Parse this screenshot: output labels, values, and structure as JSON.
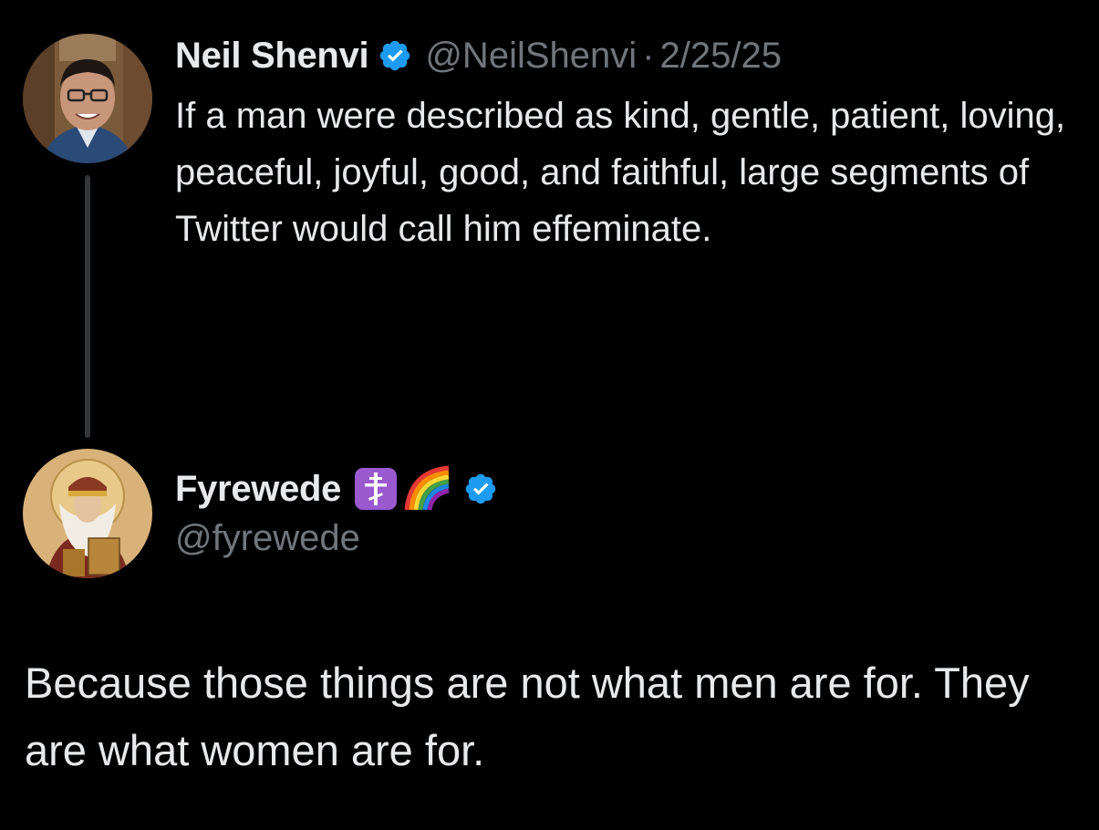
{
  "original_tweet": {
    "display_name": "Neil Shenvi",
    "handle": "@NeilShenvi",
    "separator": "·",
    "date": "2/25/25",
    "verified": true,
    "avatar_icon": "person-portrait-avatar",
    "text": "If a man were described as kind, gentle, patient, loving, peaceful, joyful, good, and faithful, large segments of Twitter would call him effeminate."
  },
  "reply_tweet": {
    "display_name": "Fyrewede",
    "handle": "@fyrewede",
    "verified": true,
    "name_emojis": [
      "orthodox-cross-emoji",
      "rainbow-emoji"
    ],
    "avatar_icon": "saint-icon-avatar",
    "text": "Because those things are not what men are for. They are what women are for."
  },
  "colors": {
    "background": "#000000",
    "primary_text": "#e7e9ea",
    "secondary_text": "#71767b",
    "verified_blue": "#1d9bf0",
    "thread_line": "#333639",
    "emoji_purple": "#9b59d0"
  }
}
